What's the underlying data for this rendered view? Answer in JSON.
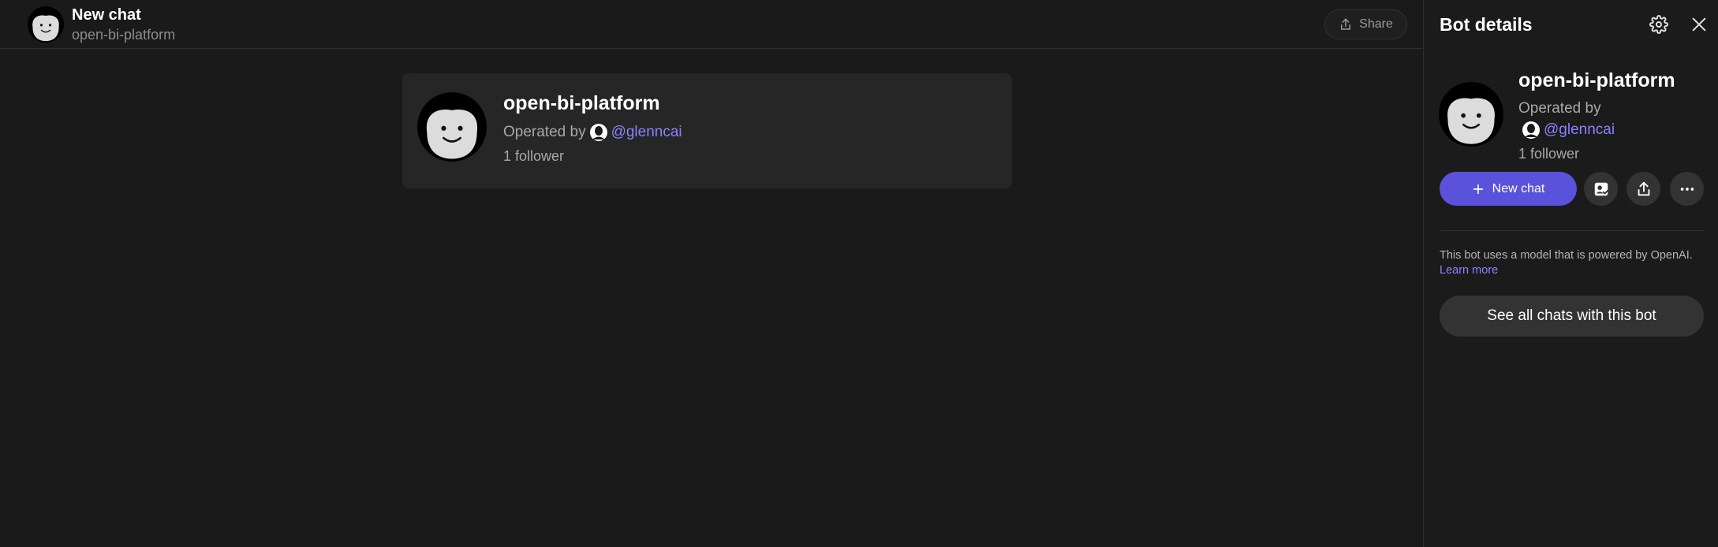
{
  "header": {
    "title": "New chat",
    "subtitle": "open-bi-platform",
    "share_label": "Share"
  },
  "bot_card": {
    "name": "open-bi-platform",
    "operated_by_label": "Operated by",
    "operator_handle": "@glenncai",
    "followers": "1 follower"
  },
  "side_panel": {
    "title": "Bot details",
    "bot_name": "open-bi-platform",
    "operated_by_label": "Operated by",
    "operator_handle": "@glenncai",
    "followers": "1 follower",
    "new_chat_label": "New chat",
    "disclaimer": "This bot uses a model that is powered by OpenAI.",
    "learn_more_label": "Learn more",
    "see_all_label": "See all chats with this bot"
  },
  "colors": {
    "accent": "#5b52db",
    "link": "#8a82ff",
    "background": "#1a1a1a",
    "card": "#262626"
  },
  "icons": [
    "bot-avatar-icon",
    "share-icon",
    "gear-icon",
    "close-icon",
    "user-icon",
    "plus-icon",
    "contact-card-icon",
    "upload-icon",
    "more-dots-icon"
  ]
}
